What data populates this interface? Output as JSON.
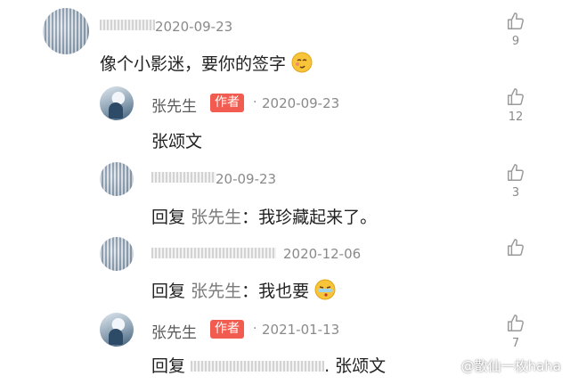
{
  "comments": [
    {
      "date": "2020-09-23",
      "text": "像个小影迷，要你的签字",
      "likes": "9"
    },
    {
      "name": "张先生",
      "badge": "作者",
      "date": "2020-09-23",
      "text": "张颂文",
      "likes": "12"
    },
    {
      "date": "20-09-23",
      "reply_prefix": "回复",
      "mention": "张先生",
      "text": "：我珍藏起来了。",
      "likes": "3"
    },
    {
      "date": "2020-12-06",
      "reply_prefix": "回复",
      "mention": "张先生",
      "text": "：我也要",
      "likes": ""
    },
    {
      "name": "张先生",
      "badge": "作者",
      "date": "2021-01-13",
      "reply_prefix": "回复",
      "text": ". 张颂文",
      "likes": "7"
    }
  ],
  "watermark": "@散仙一枚haha",
  "icons": {
    "like": "thumbs-up-icon",
    "emoji1": "blushing-face-icon",
    "emoji2": "kissing-face-icon"
  }
}
